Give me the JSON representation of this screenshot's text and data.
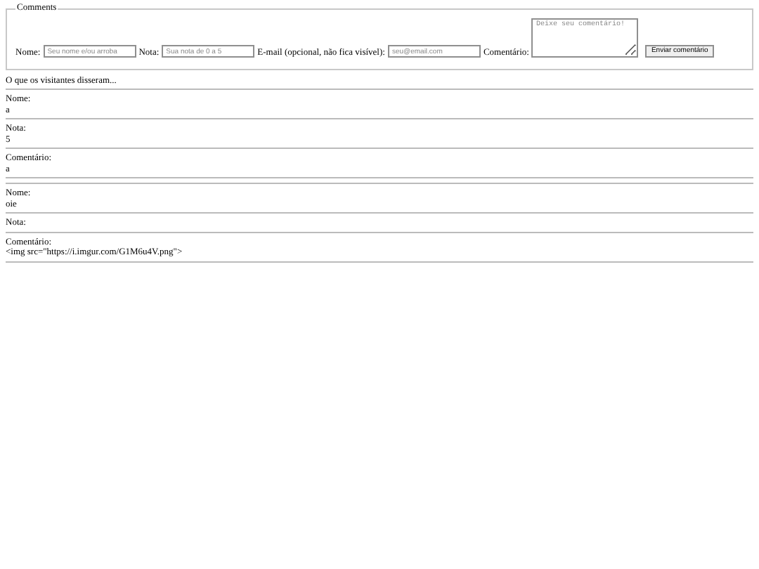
{
  "form": {
    "legend": "Comments",
    "fields": [
      {
        "kind": "input",
        "label": "Nome:",
        "placeholder": "Seu nome e/ou arroba"
      },
      {
        "kind": "input",
        "label": "Nota:",
        "placeholder": "Sua nota de 0 a 5"
      },
      {
        "kind": "input",
        "label": "E-mail (opcional, não fica visível):",
        "placeholder": "seu@email.com"
      },
      {
        "kind": "textarea",
        "label": "Comentário:",
        "placeholder": "Deixe seu comentário!"
      }
    ],
    "button": "Enviar comentário"
  },
  "heading": "O que os visitantes disseram...",
  "comments": [
    {
      "fields": [
        {
          "label": "Nome:",
          "value": "a"
        },
        {
          "label": "Nota:",
          "value": "5"
        },
        {
          "label": "Comentário:",
          "value": "a"
        }
      ]
    },
    {
      "fields": [
        {
          "label": "Nome:",
          "value": "oie"
        },
        {
          "label": "Nota:"
        },
        {
          "label": "Comentário:",
          "value": "<img src=\"https://i.imgur.com/G1M6u4V.png\">"
        }
      ]
    }
  ]
}
